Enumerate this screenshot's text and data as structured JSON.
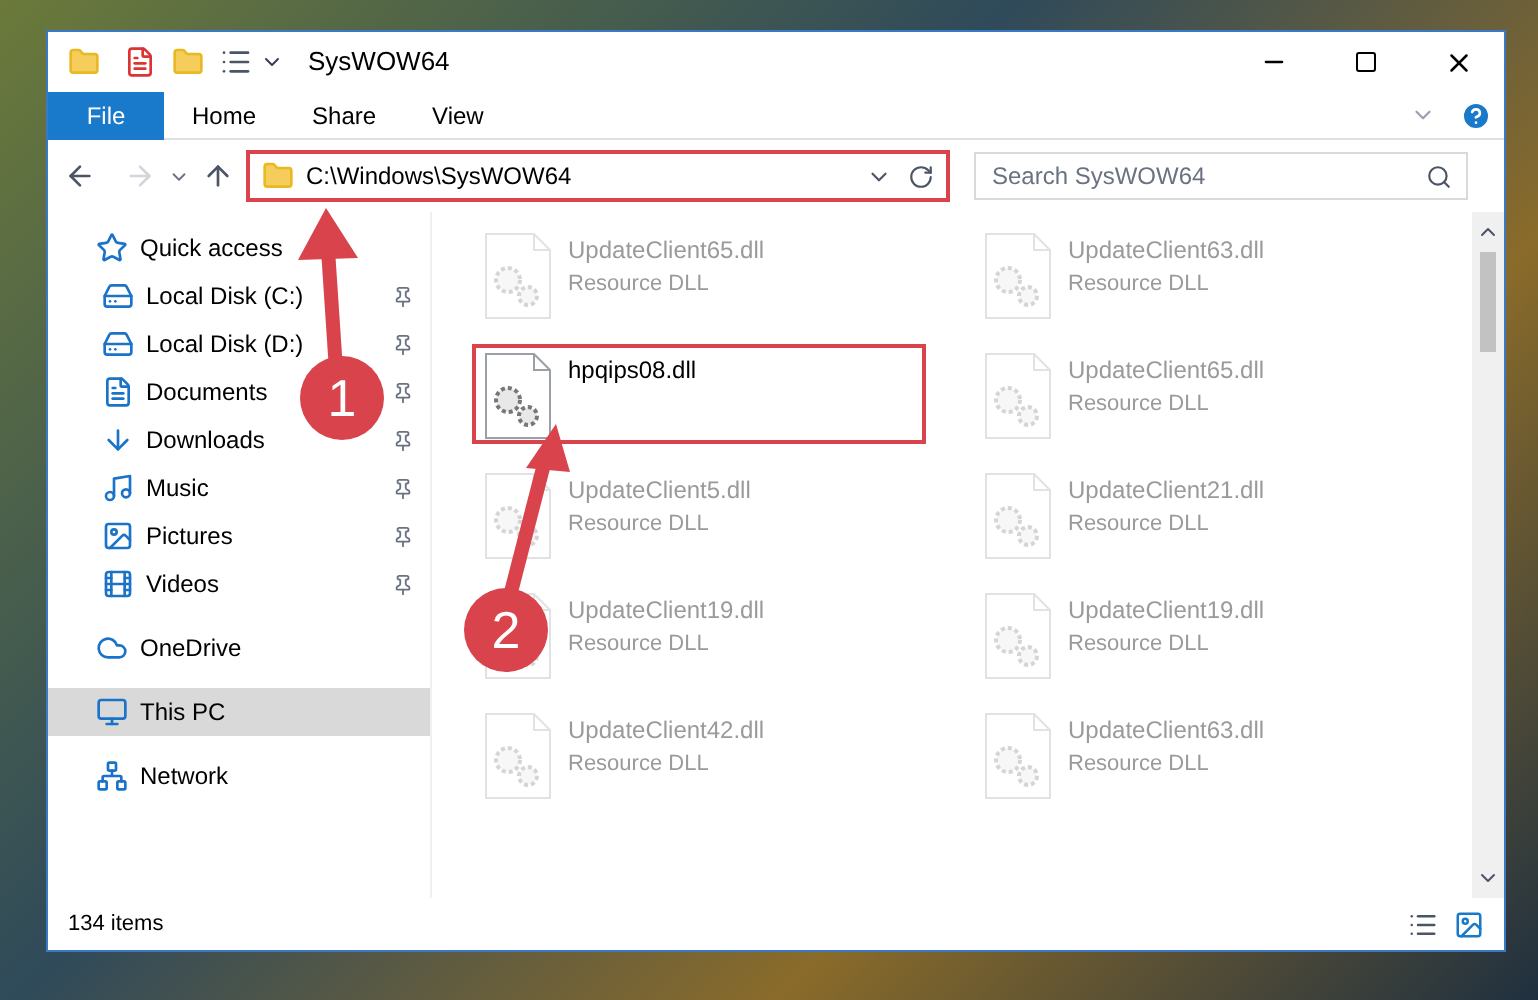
{
  "window": {
    "title": "SysWOW64"
  },
  "ribbon": {
    "tabs": [
      {
        "label": "File",
        "kind": "file"
      },
      {
        "label": "Home",
        "kind": "tab"
      },
      {
        "label": "Share",
        "kind": "tab"
      },
      {
        "label": "View",
        "kind": "tab"
      }
    ]
  },
  "address_bar": {
    "path": "C:\\Windows\\SysWOW64",
    "highlighted": true
  },
  "search": {
    "placeholder": "Search SysWOW64"
  },
  "sidebar": {
    "items": [
      {
        "label": "Quick access",
        "selected": false,
        "children": [
          {
            "label": "Local Disk (C:)",
            "selected": false,
            "pinned": true
          },
          {
            "label": "Local Disk (D:)",
            "selected": false,
            "pinned": true
          },
          {
            "label": "Documents",
            "selected": false,
            "pinned": true
          },
          {
            "label": "Downloads",
            "selected": false,
            "pinned": true
          },
          {
            "label": "Music",
            "selected": false,
            "pinned": true
          },
          {
            "label": "Pictures",
            "selected": false,
            "pinned": true
          },
          {
            "label": "Videos",
            "selected": false,
            "pinned": true
          }
        ]
      },
      {
        "label": "OneDrive",
        "selected": false
      },
      {
        "label": "This PC",
        "selected": true
      },
      {
        "label": "Network",
        "selected": false
      }
    ]
  },
  "files": [
    {
      "name": "UpdateClient65.dll",
      "type": "Resource DLL",
      "faded": true,
      "highlighted": false
    },
    {
      "name": "UpdateClient63.dll",
      "type": "Resource DLL",
      "faded": true,
      "highlighted": false
    },
    {
      "name": "hpqips08.dll",
      "faded": false,
      "highlighted": true
    },
    {
      "name": "UpdateClient65.dll",
      "type": "Resource DLL",
      "faded": true,
      "highlighted": false
    },
    {
      "name": "UpdateClient5.dll",
      "type": "Resource DLL",
      "faded": true,
      "highlighted": false
    },
    {
      "name": "UpdateClient21.dll",
      "type": "Resource DLL",
      "faded": true,
      "highlighted": false
    },
    {
      "name": "UpdateClient19.dll",
      "type": "Resource DLL",
      "faded": true,
      "highlighted": false
    },
    {
      "name": "UpdateClient19.dll",
      "type": "Resource DLL",
      "faded": true,
      "highlighted": false
    },
    {
      "name": "UpdateClient42.dll",
      "type": "Resource DLL",
      "faded": true,
      "highlighted": false
    },
    {
      "name": "UpdateClient63.dll",
      "type": "Resource DLL",
      "faded": true,
      "highlighted": false
    }
  ],
  "status_bar": {
    "count": "134 items"
  },
  "callouts": [
    {
      "number": "1"
    },
    {
      "number": "2"
    }
  ]
}
